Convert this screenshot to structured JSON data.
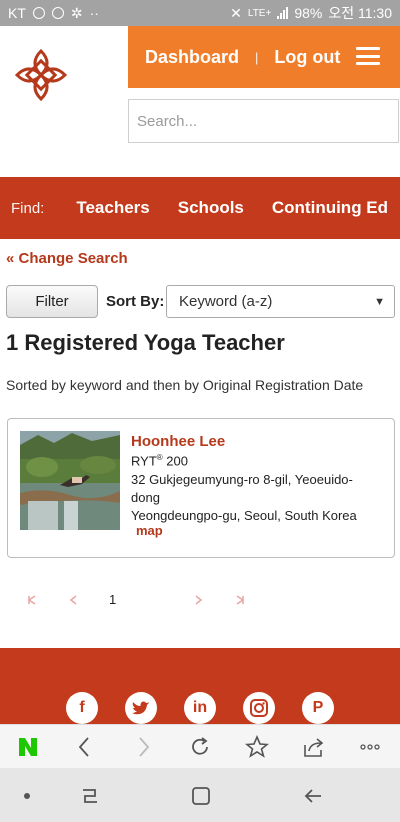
{
  "status_bar": {
    "carrier": "KT",
    "battery": "98%",
    "time": "오전 11:30",
    "network": "LTE+"
  },
  "header": {
    "nav_links": [
      "Dashboard",
      "Log out"
    ],
    "separator": "|",
    "search_placeholder": "Search..."
  },
  "findbar": {
    "label": "Find:",
    "links": [
      "Teachers",
      "Schools",
      "Continuing Ed"
    ]
  },
  "results": {
    "change_search": "Change Search",
    "filter_label": "Filter",
    "sort_label": "Sort By:",
    "sort_value": "Keyword (a-z)",
    "title": "1 Registered Yoga Teacher",
    "sort_note": "Sorted by keyword and then by Original Registration Date"
  },
  "teacher": {
    "name": "Hoonhee Lee",
    "credential": "RYT",
    "credential_mark": "®",
    "credential_level": "200",
    "address_line1": "32 Gukjegeumyung-ro 8-gil, Yeoeuido-dong",
    "address_line2": "Yeongdeungpo-gu, Seoul, South Korea",
    "map_label": "map"
  },
  "pagination": {
    "current_page": "1"
  },
  "footer": {
    "social_icons": [
      "facebook-icon",
      "twitter-icon",
      "linkedin-icon",
      "instagram-icon",
      "pinterest-icon"
    ]
  },
  "colors": {
    "orange": "#ef7d29",
    "brand_red": "#c33a1c",
    "link_red": "#b5391b",
    "naver_green": "#1ec800"
  }
}
